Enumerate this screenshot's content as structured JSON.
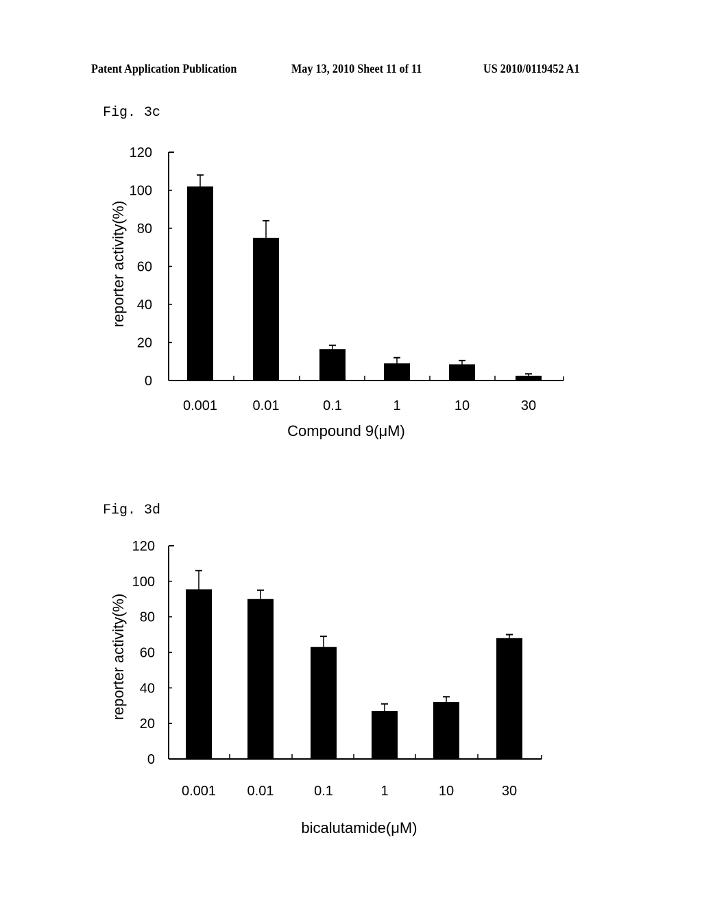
{
  "header": {
    "left": "Patent Application Publication",
    "middle": "May 13, 2010  Sheet 11 of 11",
    "right": "US 2010/0119452 A1"
  },
  "figures": [
    {
      "label": "Fig. 3c"
    },
    {
      "label": "Fig. 3d"
    }
  ],
  "chart_data": [
    {
      "type": "bar",
      "title": "Fig. 3c",
      "xlabel": "Compound 9(μM)",
      "ylabel": "reporter activity(%)",
      "categories": [
        "0.001",
        "0.01",
        "0.1",
        "1",
        "10",
        "30"
      ],
      "values": [
        102,
        75,
        16.5,
        9,
        8.5,
        2.5
      ],
      "error_upper": [
        108,
        84,
        18.5,
        12,
        10.5,
        3.5
      ],
      "ylim": [
        0,
        120
      ],
      "yticks": [
        "0",
        "20",
        "40",
        "60",
        "80",
        "100",
        "120"
      ],
      "grid": false,
      "legend": "none"
    },
    {
      "type": "bar",
      "title": "Fig. 3d",
      "xlabel": "bicalutamide(μM)",
      "ylabel": "reporter activity(%)",
      "categories": [
        "0.001",
        "0.01",
        "0.1",
        "1",
        "10",
        "30"
      ],
      "values": [
        95.5,
        90,
        63,
        27,
        32,
        68
      ],
      "error_upper": [
        106,
        95,
        69,
        31,
        35,
        70
      ],
      "ylim": [
        0,
        120
      ],
      "yticks": [
        "0",
        "20",
        "40",
        "60",
        "80",
        "100",
        "120"
      ],
      "grid": false,
      "legend": "none"
    }
  ]
}
